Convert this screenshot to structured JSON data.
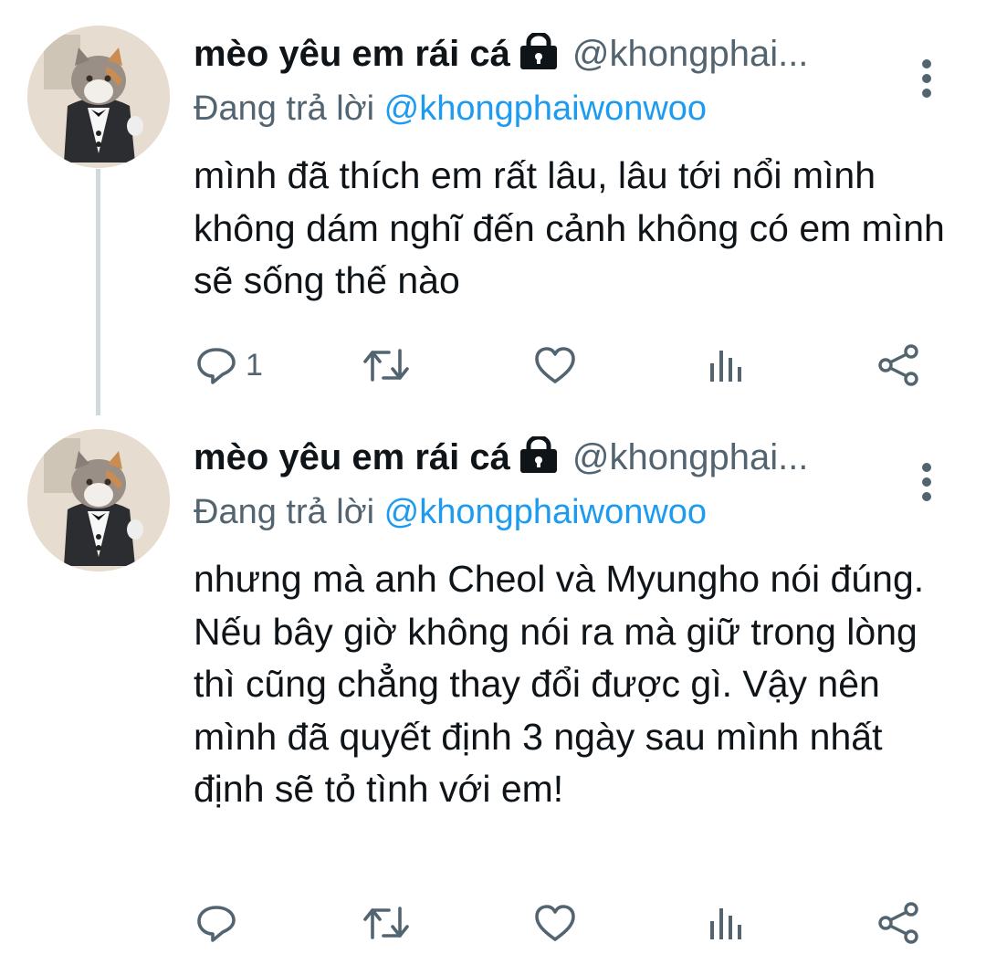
{
  "tweets": [
    {
      "display_name": "mèo yêu em rái cá",
      "handle": "@khongphai...",
      "replying_prefix": "Đang trả lời",
      "replying_to": "@khongphaiwonwoo",
      "text": "mình đã thích em rất lâu, lâu tới nổi mình không dám nghĩ đến cảnh không có em mình sẽ sống thế nào",
      "reply_count": "1",
      "retweet_count": "",
      "like_count": ""
    },
    {
      "display_name": "mèo yêu em rái cá",
      "handle": "@khongphai...",
      "replying_prefix": "Đang trả lời",
      "replying_to": "@khongphaiwonwoo",
      "text": "nhưng mà anh Cheol và Myungho nói đúng. Nếu bây giờ không nói ra mà giữ trong lòng thì cũng chẳng thay đổi được gì. Vậy nên mình đã quyết định 3 ngày sau mình nhất định sẽ tỏ tình với em!",
      "reply_count": "",
      "retweet_count": "",
      "like_count": ""
    }
  ],
  "colors": {
    "icon": "#536471",
    "mention": "#1d9bf0",
    "thread_line": "#cfd9de"
  },
  "icons": [
    "lock-icon",
    "more-vertical-icon",
    "reply-icon",
    "retweet-icon",
    "like-icon",
    "analytics-icon",
    "share-icon"
  ]
}
